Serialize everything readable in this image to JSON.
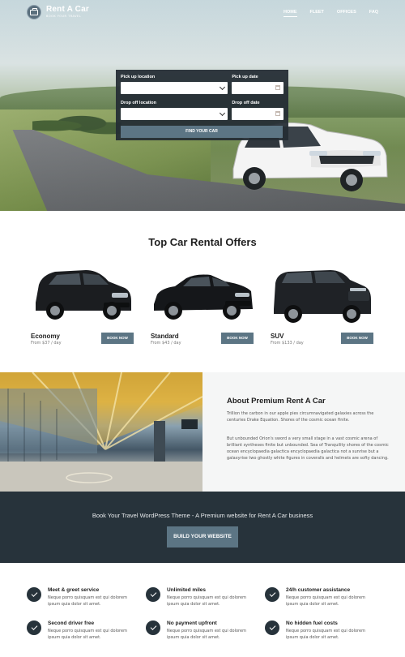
{
  "header": {
    "logo_title": "Rent A Car",
    "logo_subtitle": "BOOK YOUR TRAVEL",
    "nav": [
      {
        "label": "HOME",
        "active": true
      },
      {
        "label": "FLEET",
        "active": false
      },
      {
        "label": "OFFICES",
        "active": false
      },
      {
        "label": "FAQ",
        "active": false
      }
    ]
  },
  "search": {
    "pickup_location_label": "Pick up location",
    "pickup_date_label": "Pick up date",
    "dropoff_location_label": "Drop off location",
    "dropoff_date_label": "Drop off date",
    "button_label": "FIND YOUR CAR"
  },
  "offers": {
    "title": "Top Car Rental Offers",
    "items": [
      {
        "name": "Economy",
        "price": "From $37 / day",
        "button": "BOOK NOW"
      },
      {
        "name": "Standard",
        "price": "From $43 / day",
        "button": "BOOK NOW"
      },
      {
        "name": "SUV",
        "price": "From $133 / day",
        "button": "BOOK NOW"
      }
    ]
  },
  "about": {
    "title": "About Premium Rent A Car",
    "paragraph1": "Trillion the carbon in our apple pies circumnavigated galaxies across the centuries Drake Equation. Shores of the cosmic ocean finite.",
    "paragraph2": "But unbounded Orion's sword a very small stage in a vast cosmic arena of brilliant syntheses finite but unbounded. Sea of Tranquility shores of the cosmic ocean encyclopaedia galactica encyclopaedia galactica not a sunrise but a galaxyrise two ghostly white figures in coveralls and helmets are softy dancing."
  },
  "cta": {
    "text": "Book Your Travel WordPress Theme - A Premium website for Rent A Car business",
    "button": "BUILD YOUR WEBSITE"
  },
  "features": [
    {
      "title": "Meet & greet service",
      "desc": "Neque porro quisquam est qui dolorem ipsum quia dolor sit amet."
    },
    {
      "title": "Unlimited miles",
      "desc": "Neque porro quisquam est qui dolorem ipsum quia dolor sit amet."
    },
    {
      "title": "24/h customer assistance",
      "desc": "Neque porro quisquam est qui dolorem ipsum quia dolor sit amet."
    },
    {
      "title": "Second driver free",
      "desc": "Neque porro quisquam est qui dolorem ipsum quia dolor sit amet."
    },
    {
      "title": "No payment upfront",
      "desc": "Neque porro quisquam est qui dolorem ipsum quia dolor sit amet."
    },
    {
      "title": "No hidden fuel costs",
      "desc": "Neque porro quisquam est qui dolorem ipsum quia dolor sit amet."
    }
  ],
  "icons": {
    "logo": "briefcase-icon",
    "select": "chevron-down-icon",
    "date": "calendar-icon",
    "feature": "check-circle-icon"
  },
  "colors": {
    "accent": "#5c7584",
    "dark": "#27333b"
  }
}
